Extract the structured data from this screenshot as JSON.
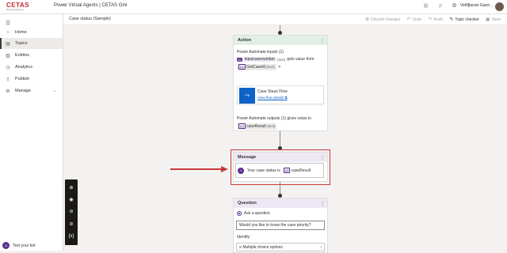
{
  "topbar": {
    "logo_text": "CETAS",
    "logo_tagline": "Building Intelligence",
    "app_title": "Power Virtual Agents | CETAS Gini",
    "user_name": "Vidhyarani Ganir...",
    "icons": [
      "settings-ring-icon",
      "bell-icon",
      "gear-icon",
      "help-icon"
    ]
  },
  "commandbar": {
    "page_title": "Case status (Sample)",
    "discard": "Discard changes",
    "undo": "Undo",
    "redo": "Redo",
    "topic_checker": "Topic checker",
    "save": "Save"
  },
  "sidebar": {
    "items": [
      {
        "label": "Home",
        "icon": "home-icon"
      },
      {
        "label": "Topics",
        "icon": "topics-icon"
      },
      {
        "label": "Entities",
        "icon": "entities-icon"
      },
      {
        "label": "Analytics",
        "icon": "analytics-icon"
      },
      {
        "label": "Publish",
        "icon": "publish-icon"
      },
      {
        "label": "Manage",
        "icon": "manage-icon"
      }
    ],
    "active": "Topics",
    "test_bot": "Test your bot"
  },
  "zoom": {
    "icons": [
      "zoom-in-icon",
      "center-icon",
      "zoom-out-icon",
      "reset-icon",
      "variables-icon"
    ],
    "variables_label": "{x}"
  },
  "action_node": {
    "title": "Action",
    "inputs_label": "Power Automate inputs (1)",
    "input_var": "inputcasenumber",
    "input_type": "(text)",
    "gets_value_from": "gets value from",
    "source_var": "GetCaseId",
    "source_type": "(text)",
    "flow_name": "Case Staus Flow",
    "flow_link": "View flow details",
    "outputs_label": "Power Automate outputs (1) gives value to",
    "output_var": "caseResult",
    "output_type": "(text)"
  },
  "message_node": {
    "title": "Message",
    "text": "Your case status is",
    "var": "caseResult"
  },
  "question_node": {
    "title": "Question",
    "ask_label": "Ask a question",
    "question_text": "Would you like to know the case priority?",
    "identify_label": "Identify",
    "identify_value": "Multiple choice options"
  },
  "colors": {
    "brand": "#5c2d91",
    "highlight": "#c9393a",
    "action_header": "#e1efe7",
    "message_header": "#ede8f4",
    "flow_icon": "#0f62c8"
  }
}
